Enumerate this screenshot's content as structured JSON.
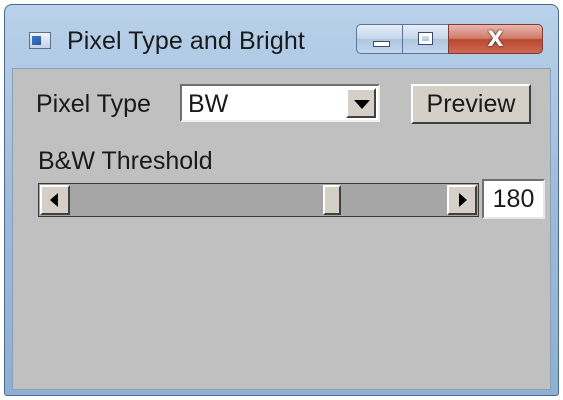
{
  "window": {
    "title": "Pixel Type and Bright",
    "icon": "app-icon",
    "caption_buttons": {
      "minimize": "minimize-icon",
      "maximize": "maximize-icon",
      "close_glyph": "X"
    }
  },
  "form": {
    "pixel_type_label": "Pixel Type",
    "pixel_type_value": "BW",
    "preview_label": "Preview",
    "threshold_label": "B&W Threshold",
    "threshold_value": "180",
    "threshold_slider_fraction": 0.705
  },
  "colors": {
    "client_background": "#c0c0c0",
    "close_button": "#c74a32",
    "title_bar": "#a9c4e2"
  }
}
